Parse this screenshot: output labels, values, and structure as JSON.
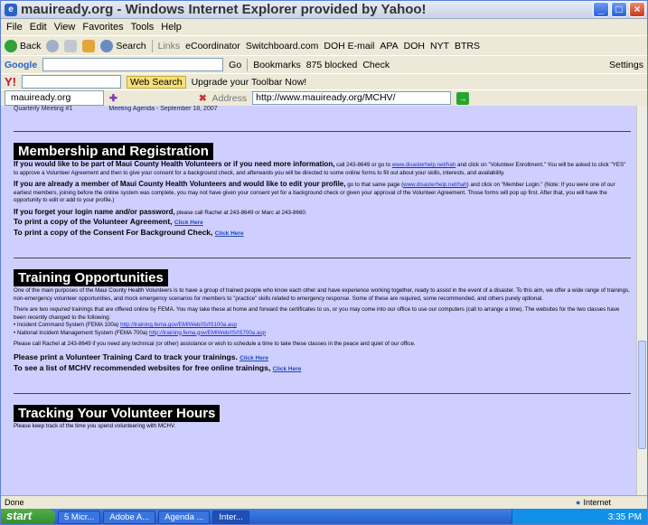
{
  "window": {
    "title": "mauiready.org - Windows Internet Explorer provided by Yahoo!"
  },
  "menu": [
    "File",
    "Edit",
    "View",
    "Favorites",
    "Tools",
    "Help"
  ],
  "toolbar": {
    "back": "Back",
    "search": "Search",
    "links_label": "Links",
    "links": [
      "eCoordinator",
      "Switchboard.com",
      "DOH E-mail",
      "APA",
      "DOH",
      "NYT",
      "BTRS"
    ]
  },
  "google_bar": {
    "go": "Go",
    "bookmarks": "Bookmarks",
    "blocked": "875 blocked",
    "check": "Check",
    "settings": "Settings"
  },
  "yahoo_bar": {
    "web_search": "Web Search",
    "upgrade": "Upgrade your Toolbar Now!"
  },
  "tab": {
    "label": "mauiready.org"
  },
  "address": {
    "label": "Address",
    "url": "http://www.mauiready.org/MCHV/"
  },
  "page": {
    "meeting_left": "Quarterly Meeting #1",
    "meeting_right": "Meeting Agenda - September 18, 2007",
    "membership": {
      "heading": "Membership and Registration",
      "p1_bold": "If you would like to be part of Maui County Health Volunteers or if you need more information,",
      "p1_text": "call 243-8649 or go to",
      "p1_link": "www.disasterhelp.net/hah",
      "p1_text2": "and click on \"Volunteer Enrollment.\" You will be asked to click \"YES\" to approve a Volunteer Agreement and then to give your consent for a background check, and afterwards you will be directed to some online forms to fill out about your skills, interests, and availability.",
      "p2_bold": "If you are already a member of Maui County Health Volunteers and would like to edit your profile,",
      "p2_text": "go to that same page",
      "p2_link": "www.disasterhelp.net/hah",
      "p2_text2": "and click on \"Member Login.\" (Note: If you were one of our earliest members, joining before the online system was complete, you may not have given your consent yet for a background check or given your approval of the Volunteer Agreement. Those forms will pop up first. After that, you will have the opportunity to edit or add to your profile.)",
      "p3_bold": "If you forget your login name and/or password,",
      "p3_text": "please call Rachel at 243-8649 or Marc at 243-8660.",
      "p4_bold": "To print a copy of the Volunteer Agreement,",
      "p5_bold": "To print a copy of the Consent For Background Check,",
      "click_here": "Click Here"
    },
    "training": {
      "heading": "Training Opportunities",
      "p1": "One of the main purposes of the Maui County Health Volunteers is to have a group of trained people who know each other and have experience working together, ready to assist in the event of a disaster. To this aim, we offer a wide range of trainings, non-emergency volunteer opportunities, and mock emergency scenarios for members to \"practice\" skills related to emergency response. Some of these are required, some recommended, and others purely optional.",
      "p2_pre": "There are two",
      "p2_em": "required",
      "p2_post": "trainings that are offered online by FEMA. You may take these at home and forward the certificates to us, or you may come into our office to use our computers (call to arrange a time). The websites for the two classes have been recently changed to the following:",
      "item1_text": "• Incident Command System (FEMA 100a)",
      "item1_link": "http://training.fema.gov/EMIWeb/IS/IS100a.asp",
      "item2_text": "• National Incident Management System (FEMA 700a)",
      "item2_link": "http://training.fema.gov/EMIWeb/IS/IS700a.asp",
      "p3": "Please call Rachel at 243-8649 if you need any technical (or other) assistance or wish to schedule a time to take these classes in the peace and quiet of our office.",
      "p4_bold": "Please print a Volunteer Training Card to track your trainings.",
      "p5_bold": "To see a list of MCHV recommended websites for free online trainings,",
      "click_here": "Click Here"
    },
    "hours": {
      "heading": "Tracking Your Volunteer Hours",
      "p1": "Please keep track of the time you spend volunteering with MCHV."
    }
  },
  "status": {
    "left": "Done",
    "zone": "Internet"
  },
  "taskbar": {
    "start": "start",
    "tasks": [
      "5 Micr...",
      "Adobe A...",
      "Agenda ...",
      "Inter..."
    ],
    "clock": "3:35 PM"
  }
}
